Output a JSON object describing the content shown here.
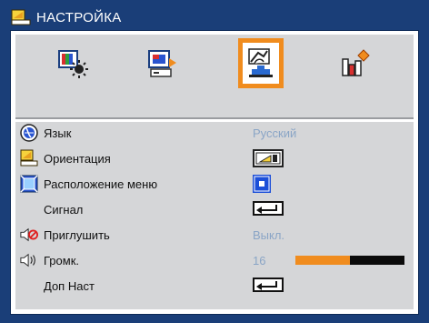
{
  "window": {
    "title": "НАСТРОЙКА",
    "title_icon": "projector-orientation-icon"
  },
  "tabs": [
    {
      "name": "image-settings-tab",
      "icon": "color-bars-sun-icon",
      "selected": false
    },
    {
      "name": "display-tab",
      "icon": "screen-swap-icon",
      "selected": false
    },
    {
      "name": "setup-tab",
      "icon": "hand-projector-icon",
      "selected": true
    },
    {
      "name": "options-tab",
      "icon": "bar-chart-diamond-icon",
      "selected": false
    }
  ],
  "menu": {
    "items": [
      {
        "label": "Язык",
        "value": "Русский",
        "icon": "globe-icon"
      },
      {
        "label": "Ориентация",
        "icon": "projector-orientation-icon",
        "control": "orientation-picture"
      },
      {
        "label": "Расположение меню",
        "icon": "menu-location-icon",
        "control": "menu-location-picture"
      },
      {
        "label": "Сигнал",
        "control": "enter-button"
      },
      {
        "label": "Приглушить",
        "value": "Выкл.",
        "icon": "mute-speaker-icon"
      },
      {
        "label": "Громк.",
        "value": "16",
        "icon": "volume-speaker-icon",
        "level_percent": 50
      },
      {
        "label": "Доп Наст",
        "control": "enter-button"
      }
    ]
  },
  "colors": {
    "background": "#1a3e78",
    "panel": "#d5d6d8",
    "accent": "#f08c1e",
    "value_text": "#8aa5c6"
  }
}
